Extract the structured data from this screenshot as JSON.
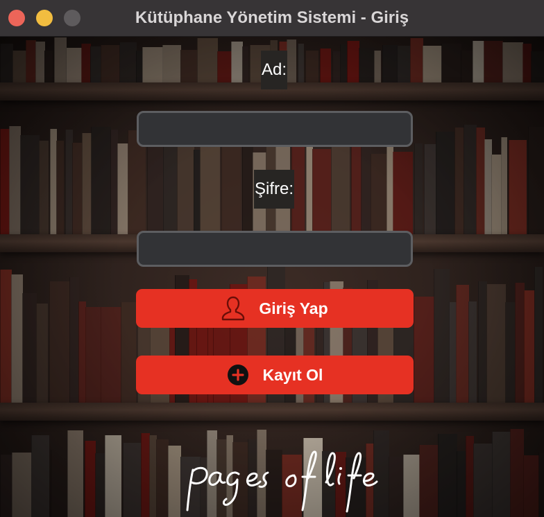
{
  "window": {
    "title": "Kütüphane Yönetim Sistemi - Giriş"
  },
  "form": {
    "username_label": "Ad:",
    "username_value": "",
    "password_label": "Şifre:",
    "password_value": "",
    "login_button": "Giriş Yap",
    "register_button": "Kayıt Ol"
  },
  "icons": {
    "login": "user-icon",
    "register": "plus-circle-icon"
  },
  "branding": {
    "logo_text": "pages of life"
  },
  "colors": {
    "accent": "#e63123",
    "field_bg": "#323336",
    "field_border": "#5d5e61",
    "titlebar": "#373436"
  }
}
